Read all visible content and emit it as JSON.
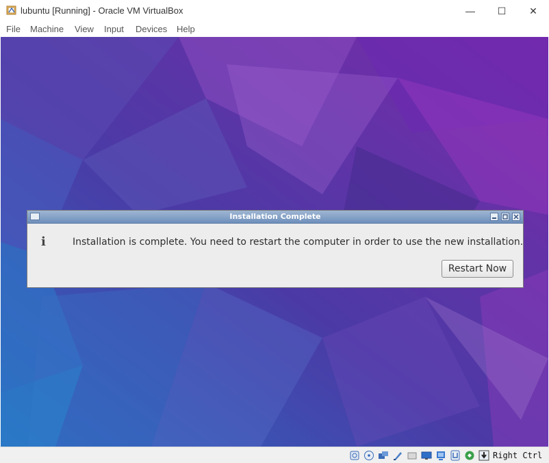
{
  "window": {
    "title": "lubuntu [Running] - Oracle VM VirtualBox",
    "minimize_glyph": "—",
    "maximize_glyph": "☐",
    "close_glyph": "✕"
  },
  "menu": {
    "items": [
      "File",
      "Machine",
      "View",
      "Input",
      "Devices",
      "Help"
    ]
  },
  "dialog": {
    "title": "Installation Complete",
    "icon": "i",
    "message": "Installation is complete. You need to restart the computer in order to use the new installation.",
    "button_label": "Restart Now"
  },
  "statusbar": {
    "icons": [
      "hard-disk-icon",
      "optical-drive-icon",
      "audio-icon",
      "network-icon",
      "usb-icon",
      "shared-folders-icon",
      "display-icon",
      "video-capture-icon",
      "recording-icon",
      "cpu-virtualization-icon",
      "keyboard-capture-icon",
      "mouse-integration-icon"
    ],
    "host_key": "Right Ctrl"
  },
  "colors": {
    "dialog_titlebar": "#7f9cc4",
    "desktop_base": "#4a3aa0"
  }
}
